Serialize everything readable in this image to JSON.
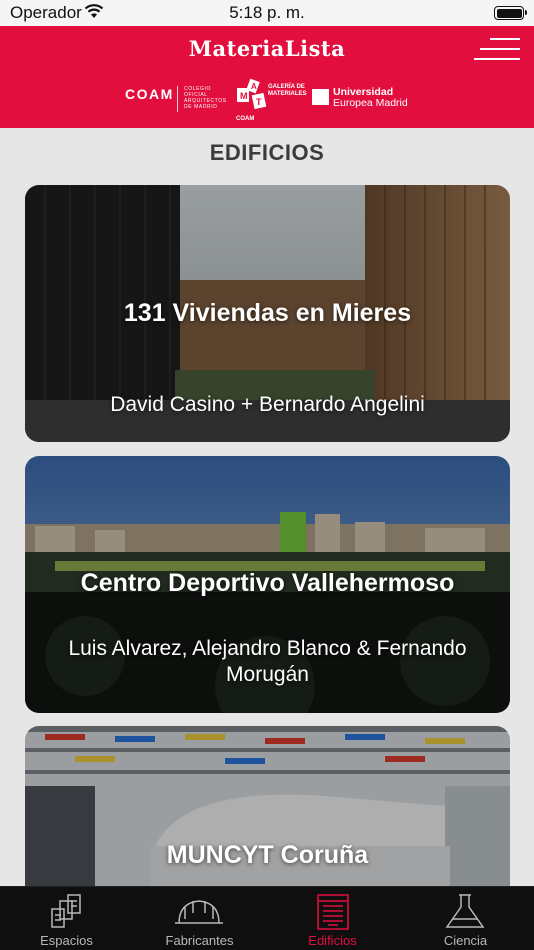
{
  "status_bar": {
    "carrier": "Operador",
    "time": "5:18 p. m."
  },
  "header": {
    "brand": "MateriaLista",
    "logos": {
      "coam": "COAM",
      "coam_sub": "COLEGIO OFICIAL ARQUITECTOS DE MADRID",
      "mat": "MAT COAM",
      "galeria": "GALERÍA DE MATERIALES",
      "uem_line1": "Universidad",
      "uem_line2": "Europea Madrid"
    }
  },
  "section_title": "EDIFICIOS",
  "cards": [
    {
      "title": "131 Viviendas en Mieres",
      "author": "David Casino + Bernardo Angelini"
    },
    {
      "title": "Centro Deportivo Vallehermoso",
      "author": "Luis Alvarez, Alejandro Blanco & Fernando Morugán"
    },
    {
      "title": "MUNCYT Coruña",
      "author": ""
    }
  ],
  "tabs": [
    {
      "label": "Espacios",
      "icon": "espacios-icon",
      "active": false
    },
    {
      "label": "Fabricantes",
      "icon": "helmet-icon",
      "active": false
    },
    {
      "label": "Edificios",
      "icon": "building-icon",
      "active": true
    },
    {
      "label": "Ciencia",
      "icon": "flask-icon",
      "active": false
    }
  ],
  "colors": {
    "brand_red": "#e20f3e",
    "tabbar_bg": "#0f0f0f",
    "page_bg": "#e6e6e6"
  }
}
